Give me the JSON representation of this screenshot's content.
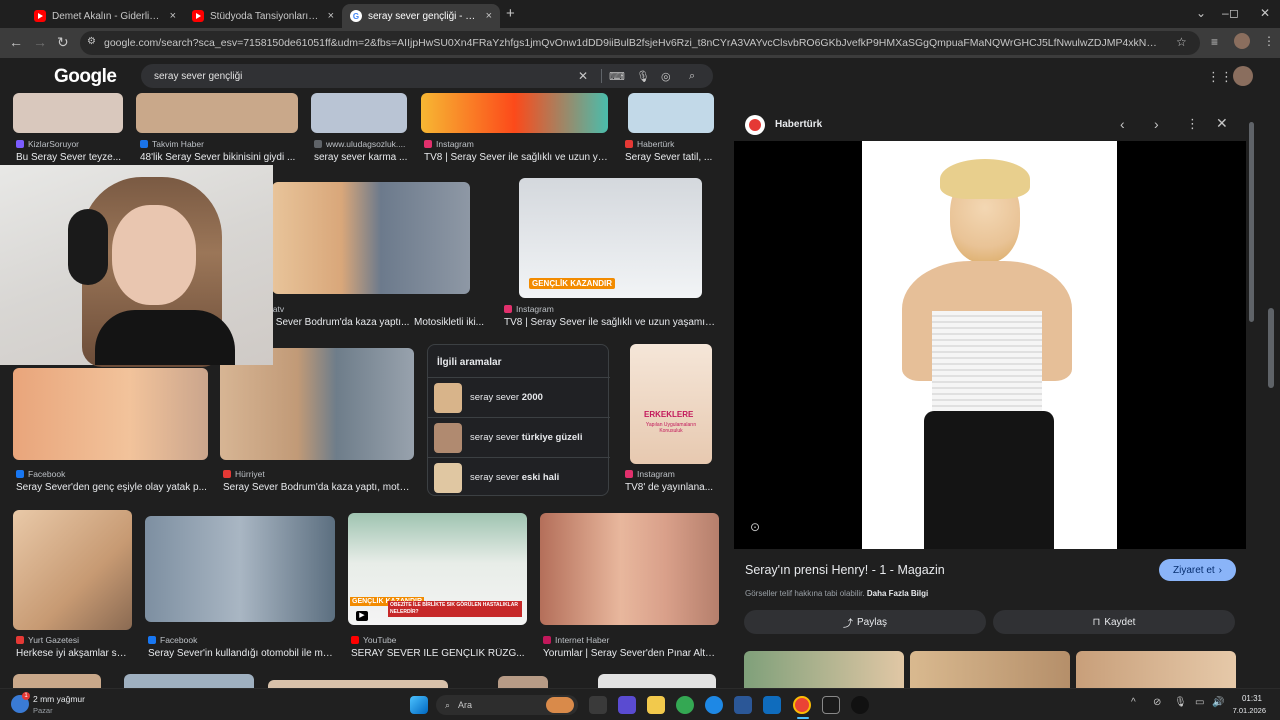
{
  "tabs": [
    {
      "title": "Demet Akalın - Giderli Şarkılar",
      "close": "×"
    },
    {
      "title": "Stüdyoda Tansiyonları Yükselten",
      "close": "×"
    },
    {
      "title": "seray sever gençliği - Google'da",
      "close": "×"
    },
    {
      "new_tab": "+"
    }
  ],
  "window_controls": {
    "chevron": "⌄",
    "minimize": "–",
    "maximize": "◻",
    "close": "✕"
  },
  "toolbar": {
    "back": "←",
    "forward": "→",
    "reload": "↻",
    "url": "google.com/search?sca_esv=7158150de61051ff&udm=2&fbs=AIIjpHwSU0Xn4FRaYzhfgs1jmQvOnw1dDD9iiBulB2fsjeHv6Rzi_t8nCYrA3VAYvcClsvbRO6GKbJvefkP9HMXaSGgQmpuaFMaNQWrGHCJ5LfNwulwZDJMP4xkNMC0JqsWEg8WYUYNoy2rH033Y7dB21..."
  },
  "search": {
    "logo": "Google",
    "query": "seray sever gençliği"
  },
  "results": {
    "row1": [
      {
        "source": "KizlarSoruyor",
        "caption": "Bu Seray Sever teyze...",
        "color": "#7b5cff"
      },
      {
        "source": "Takvim Haber",
        "caption": "48'lik Seray Sever bikinisini giydi ...",
        "color": "#1a73e8"
      },
      {
        "source": "www.uludagsozluk....",
        "caption": "seray sever karma ...",
        "color": "#5f6368"
      },
      {
        "source": "Instagram",
        "caption": "TV8 | Seray Sever ile sağlıklı ve uzun ya...",
        "color": "#e1306c"
      },
      {
        "source": "Habertürk",
        "caption": "Seray Sever tatil, ...",
        "color": "#e53935"
      }
    ],
    "row2": [
      {
        "source": "datv",
        "caption": "y Sever Bodrum'da kaza yaptı...",
        "color": "#1a73e8"
      },
      {
        "source": "",
        "caption": "Motosikletli iki...",
        "color": "#1f1f1f"
      },
      {
        "source": "Instagram",
        "caption": "TV8 | Seray Sever ile sağlıklı ve uzun yaşamın ...",
        "color": "#e1306c"
      },
      {
        "badge": "GENÇLİK KAZANDIR"
      }
    ],
    "row3": [
      {
        "source": "Facebook",
        "caption": "Seray Sever'den genç eşiyle olay yatak p...",
        "color": "#1877f2"
      },
      {
        "source": "Hürriyet",
        "caption": "Seray Sever Bodrum'da kaza yaptı, moto...",
        "color": "#e53935"
      },
      {
        "source": "Instagram",
        "caption": "TV8' de yayınlana...",
        "color": "#e1306c"
      },
      {
        "overlay_title": "ERKEKLERE",
        "overlay_sub": "Yapılan Uygulamaların Konusuluk"
      }
    ],
    "row4": [
      {
        "source": "Yurt Gazetesi",
        "caption": "Herkese iyi akşamlar se...",
        "color": "#e53935"
      },
      {
        "source": "Facebook",
        "caption": "Seray Sever'in kullandığı otomobil ile mo...",
        "color": "#1877f2"
      },
      {
        "source": "YouTube",
        "caption": "SERAY SEVER İLE GENÇLİK RÜZG...",
        "color": "#ff0000"
      },
      {
        "source": "Internet Haber",
        "caption": "Yorumlar | Seray Sever'den Pınar Altu...",
        "color": "#c2185b"
      },
      {
        "badge": "GENÇLİK KAZANDIR",
        "banner": "OBEZİTE İLE BİRLİKTE SIK GÖRÜLEN HASTALIKLAR NELERDİR?"
      }
    ]
  },
  "related": {
    "header": "İlgili aramalar",
    "items": [
      {
        "prefix": "seray sever ",
        "bold": "2000"
      },
      {
        "prefix": "seray sever ",
        "bold": "türkiye güzeli"
      },
      {
        "prefix": "seray sever ",
        "bold": "eski hali"
      }
    ]
  },
  "panel": {
    "source": "Habertürk",
    "title": "Seray'ın prensi Henry! - 1 - Magazin",
    "visit": "Ziyaret et",
    "license_text": "Görseller telif hakkına tabi olabilir.",
    "license_link": "Daha Fazla Bilgi",
    "share": "Paylaş",
    "save": "Kaydet"
  },
  "taskbar": {
    "weather_temp": "2 mm yağmur",
    "weather_day": "Pazar",
    "search_placeholder": "Ara",
    "time": "01:31",
    "date": "7.01.2026"
  }
}
